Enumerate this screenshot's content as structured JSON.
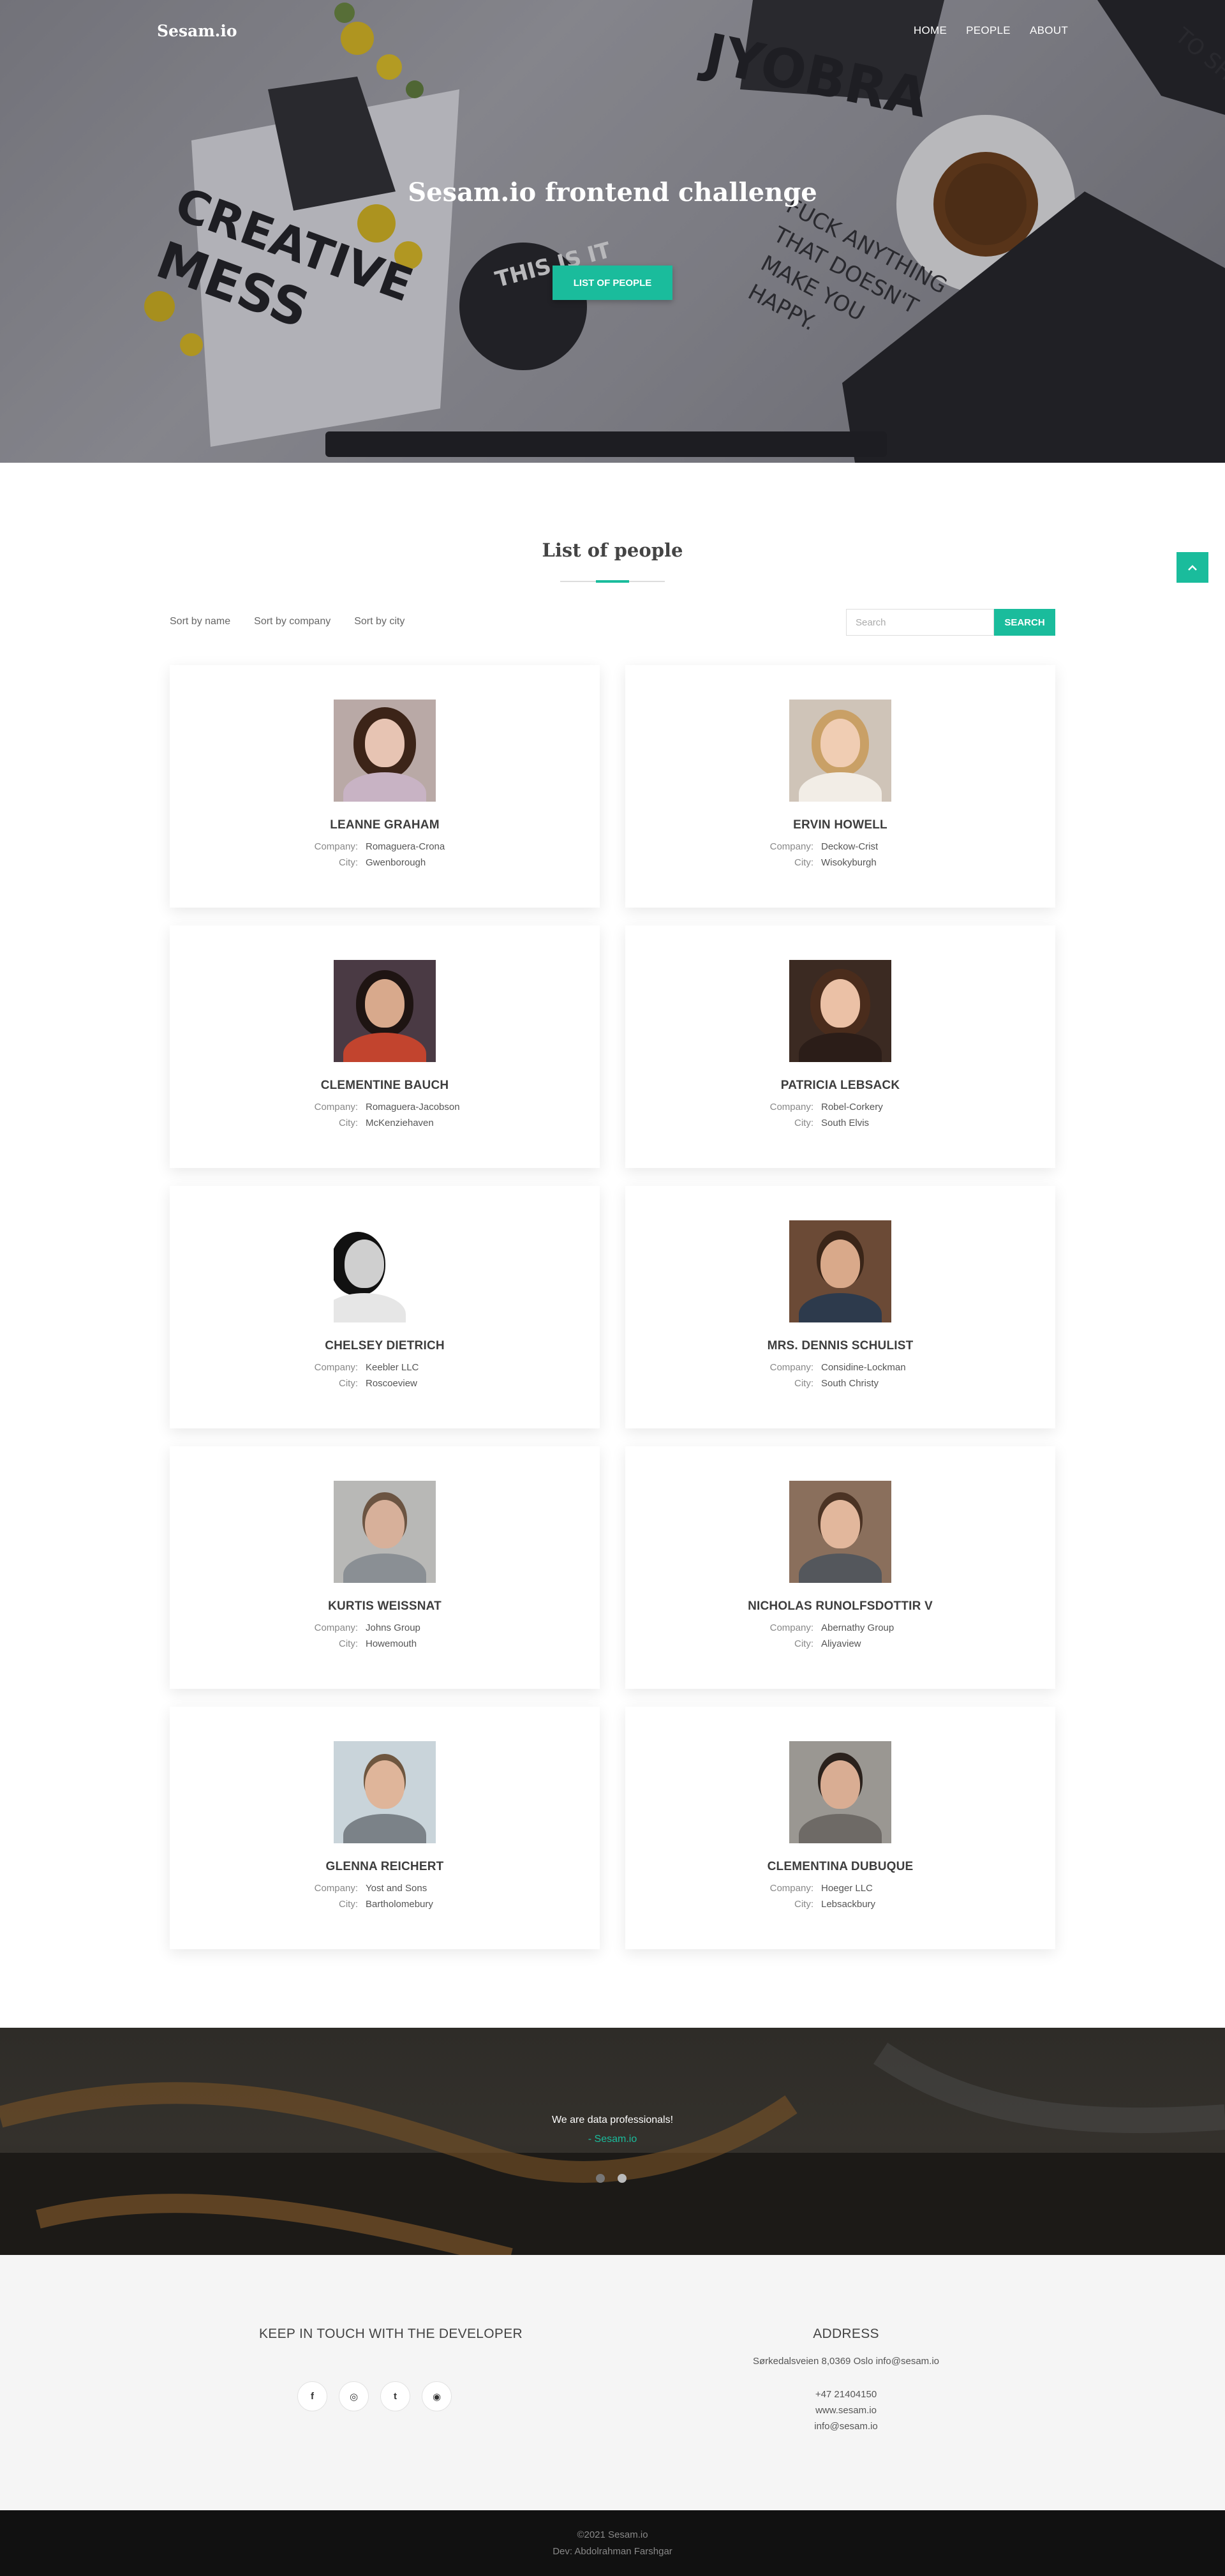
{
  "nav": {
    "brand": "Sesam.io",
    "links": [
      "HOME",
      "PEOPLE",
      "ABOUT"
    ]
  },
  "hero": {
    "title": "Sesam.io frontend challenge",
    "button": "LIST OF PEOPLE",
    "decor_texts": [
      "CREATIVE",
      "MESS",
      "THIS IS IT",
      "FUCK ANYTHING",
      "THAT DOESN'T",
      "MAKE YOU",
      "HAPPY.",
      "JYOBRA",
      "TO SHO"
    ]
  },
  "people_section": {
    "title": "List of people",
    "sort_options": [
      "Sort by name",
      "Sort by company",
      "Sort by city"
    ],
    "search_placeholder": "Search",
    "search_button": "SEARCH",
    "scroll_top_icon": "chevron-up-icon",
    "company_label": "Company:",
    "city_label": "City:",
    "people": [
      {
        "name": "LEANNE GRAHAM",
        "company": "Romaguera-Crona",
        "city": "Gwenborough"
      },
      {
        "name": "ERVIN HOWELL",
        "company": "Deckow-Crist",
        "city": "Wisokyburgh"
      },
      {
        "name": "CLEMENTINE BAUCH",
        "company": "Romaguera-Jacobson",
        "city": "McKenziehaven"
      },
      {
        "name": "PATRICIA LEBSACK",
        "company": "Robel-Corkery",
        "city": "South Elvis"
      },
      {
        "name": "CHELSEY DIETRICH",
        "company": "Keebler LLC",
        "city": "Roscoeview"
      },
      {
        "name": "MRS. DENNIS SCHULIST",
        "company": "Considine-Lockman",
        "city": "South Christy"
      },
      {
        "name": "KURTIS WEISSNAT",
        "company": "Johns Group",
        "city": "Howemouth"
      },
      {
        "name": "NICHOLAS RUNOLFSDOTTIR V",
        "company": "Abernathy Group",
        "city": "Aliyaview"
      },
      {
        "name": "GLENNA REICHERT",
        "company": "Yost and Sons",
        "city": "Bartholomebury"
      },
      {
        "name": "CLEMENTINA DUBUQUE",
        "company": "Hoeger LLC",
        "city": "Lebsackbury"
      }
    ]
  },
  "testimonial": {
    "text": "We are data professionals!",
    "author": "- Sesam.io",
    "dots": 2,
    "active_dot": 1
  },
  "footer": {
    "left_heading": "KEEP IN TOUCH WITH THE DEVELOPER",
    "social_icons": [
      "facebook-icon",
      "instagram-icon",
      "twitter-icon",
      "github-icon"
    ],
    "social_glyphs": [
      "f",
      "◎",
      "t",
      "◉"
    ],
    "right_heading": "ADDRESS",
    "address_line": "Sørkedalsveien 8,0369 Oslo info@sesam.io",
    "phone": "+47 21404150",
    "website": "www.sesam.io",
    "email": "info@sesam.io"
  },
  "bottom": {
    "copyright": "©2021 Sesam.io",
    "dev": "Dev: Abdolrahman Farshgar"
  },
  "colors": {
    "accent": "#1abc9c",
    "footer_bg": "#f5f5f5",
    "bottom_bg": "#111111"
  }
}
